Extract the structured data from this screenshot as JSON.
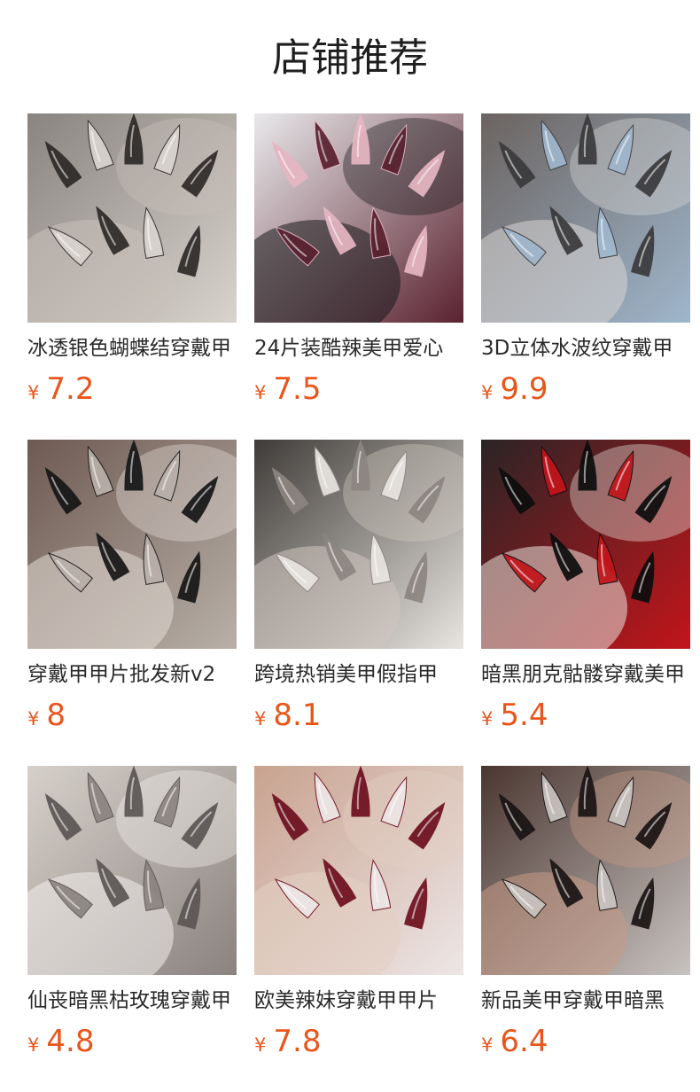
{
  "header": {
    "title": "店铺推荐"
  },
  "currency_symbol": "¥",
  "products": [
    {
      "name": "冰透银色蝴蝶结穿戴甲",
      "price": "7.2",
      "image": "clear-silver-stiletto-nails-photo",
      "palette": [
        "#8a8480",
        "#c9c1ba",
        "#2e2a28",
        "#d9d3cd"
      ]
    },
    {
      "name": "24片装酷辣美甲爱心",
      "price": "7.5",
      "image": "black-pink-heart-nails-photo",
      "palette": [
        "#e9e9eb",
        "#1a1a1c",
        "#e7b6c3",
        "#5a2230"
      ]
    },
    {
      "name": "3D立体水波纹穿戴甲",
      "price": "9.9",
      "image": "chrome-3d-stiletto-nails-photo",
      "palette": [
        "#6b6360",
        "#d8d6d4",
        "#3a3a3c",
        "#9fb6cc"
      ]
    },
    {
      "name": "穿戴甲甲片批发新v2",
      "price": "8",
      "image": "black-star-chrome-nails-photo",
      "palette": [
        "#6e5a52",
        "#e4ddd6",
        "#161616",
        "#b8b0a8"
      ]
    },
    {
      "name": "跨境热销美甲假指甲",
      "price": "8.1",
      "image": "silver-cross-stiletto-nails-photo",
      "palette": [
        "#3f3b38",
        "#cfc7bf",
        "#8c8580",
        "#e8e4e0"
      ]
    },
    {
      "name": "暗黑朋克骷髅穿戴美甲",
      "price": "5.4",
      "image": "skull-punk-black-nails-photo",
      "palette": [
        "#2a2426",
        "#e9e3dd",
        "#0d0d0d",
        "#c2151b"
      ]
    },
    {
      "name": "仙丧暗黑枯玫瑰穿戴甲",
      "price": "4.8",
      "image": "smoky-grey-rose-nails-photo",
      "palette": [
        "#d6d0ca",
        "#f2efec",
        "#5b5654",
        "#8a837f"
      ]
    },
    {
      "name": "欧美辣妹穿戴甲甲片",
      "price": "7.8",
      "image": "burgundy-chrome-cross-nails-photo",
      "palette": [
        "#c8a28f",
        "#e3cfc2",
        "#6d0f1f",
        "#ede6e6"
      ]
    },
    {
      "name": "新品美甲穿戴甲暗黑",
      "price": "6.4",
      "image": "dark-chrome-tribal-nails-photo",
      "palette": [
        "#4a3630",
        "#c79a86",
        "#1a1414",
        "#c8c3c0"
      ]
    }
  ]
}
